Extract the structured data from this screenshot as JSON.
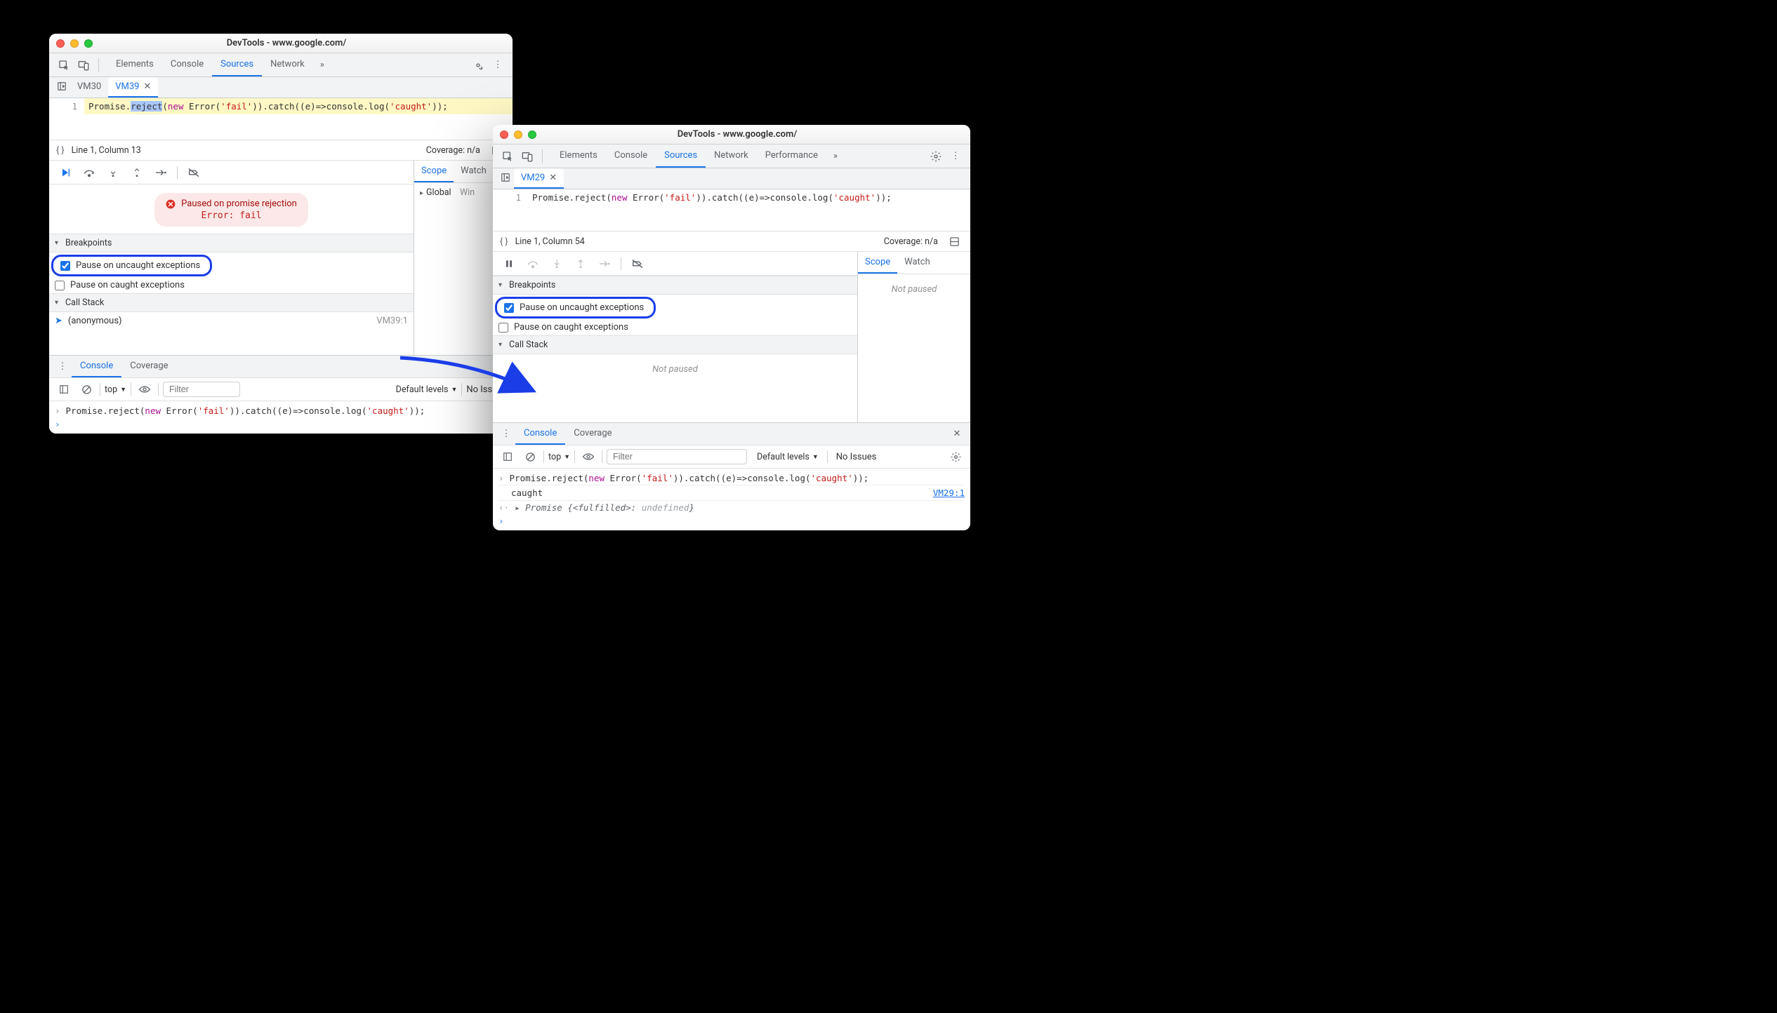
{
  "left": {
    "title": "DevTools - www.google.com/",
    "tabs": [
      "Elements",
      "Console",
      "Sources",
      "Network"
    ],
    "active_tab": "Sources",
    "vm_tabs": [
      "VM30",
      "VM39"
    ],
    "active_vm": "VM39",
    "line_number": "1",
    "code": {
      "prefix": "Promise.",
      "selected": "reject",
      "p1": "(",
      "new": "new",
      "p2": " Error(",
      "str1": "'fail'",
      "p3": ")).catch((e)=>console.log(",
      "str2": "'caught'",
      "p4": "));"
    },
    "cursor": "Line 1, Column 13",
    "coverage": "Coverage: n/a",
    "pause_title": "Paused on promise rejection",
    "pause_err": "Error: fail",
    "breakpoints_header": "Breakpoints",
    "bp_uncaught": "Pause on uncaught exceptions",
    "bp_caught": "Pause on caught exceptions",
    "callstack_header": "Call Stack",
    "call_frame": "(anonymous)",
    "call_src": "VM39:1",
    "scope_tab": "Scope",
    "watch_tab": "Watch",
    "scope_global": "Global",
    "scope_win": "Win",
    "drawer_tabs": [
      "Console",
      "Coverage"
    ],
    "drawer_active": "Console",
    "ctx": "top",
    "filter_placeholder": "Filter",
    "levels": "Default levels",
    "issues": "No Issues",
    "console_code": {
      "prefix": "Promise.reject(",
      "new": "new",
      "p2": " Error(",
      "str1": "'fail'",
      "p3": ")).catch((e)=>console.log(",
      "str2": "'caught'",
      "p4": "));"
    }
  },
  "right": {
    "title": "DevTools - www.google.com/",
    "tabs": [
      "Elements",
      "Console",
      "Sources",
      "Network",
      "Performance"
    ],
    "active_tab": "Sources",
    "vm_tabs": [
      "VM29"
    ],
    "active_vm": "VM29",
    "line_number": "1",
    "code": {
      "prefix": "Promise.reject(",
      "new": "new",
      "p2": " Error(",
      "str1": "'fail'",
      "p3": ")).catch((e)=>console.log(",
      "str2": "'caught'",
      "p4": "));"
    },
    "cursor": "Line 1, Column 54",
    "coverage": "Coverage: n/a",
    "breakpoints_header": "Breakpoints",
    "bp_uncaught": "Pause on uncaught exceptions",
    "bp_caught": "Pause on caught exceptions",
    "callstack_header": "Call Stack",
    "scope_tab": "Scope",
    "watch_tab": "Watch",
    "not_paused": "Not paused",
    "drawer_tabs": [
      "Console",
      "Coverage"
    ],
    "drawer_active": "Console",
    "ctx": "top",
    "filter_placeholder": "Filter",
    "levels": "Default levels",
    "issues": "No Issues",
    "console_code": {
      "prefix": "Promise.reject(",
      "new": "new",
      "p2": " Error(",
      "str1": "'fail'",
      "p3": ")).catch((e)=>console.log(",
      "str2": "'caught'",
      "p4": "));"
    },
    "console_out": "caught",
    "console_out_src": "VM29:1",
    "console_promise_prefix": "Promise {",
    "console_promise_state": "<fulfilled>",
    "console_promise_sep": ": ",
    "console_promise_val": "undefined",
    "console_promise_suffix": "}"
  }
}
